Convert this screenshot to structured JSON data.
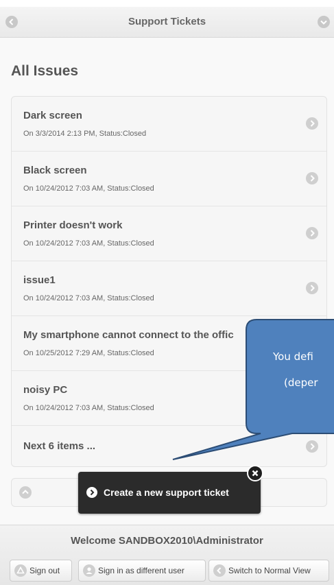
{
  "header": {
    "title": "Support Tickets"
  },
  "section": {
    "title": "All Issues"
  },
  "issues": [
    {
      "title": "Dark screen",
      "subtitle": "On 3/3/2014 2:13 PM, Status:Closed"
    },
    {
      "title": "Black screen",
      "subtitle": "On 10/24/2012 7:03 AM, Status:Closed"
    },
    {
      "title": "Printer doesn't work",
      "subtitle": "On 10/24/2012 7:03 AM, Status:Closed"
    },
    {
      "title": "issue1",
      "subtitle": "On 10/24/2012 7:03 AM, Status:Closed"
    },
    {
      "title": "My smartphone cannot connect to the offic",
      "subtitle": "On 10/25/2012 7:29 AM, Status:Closed"
    },
    {
      "title": "noisy PC",
      "subtitle": "On 10/24/2012 7:03 AM, Status:Closed"
    }
  ],
  "pager": {
    "next_label": "Next 6 items ..."
  },
  "tooltip": {
    "text": "Create a new support ticket"
  },
  "callout": {
    "line1": "You defi",
    "line2": "(deper",
    "fill_color": "#4f81bd",
    "border_color": "#2c4d75"
  },
  "footer": {
    "welcome": "Welcome SANDBOX2010\\Administrator",
    "sign_out": "Sign out",
    "sign_in_different": "Sign in as different user",
    "switch_view": "Switch to Normal View"
  },
  "icons": {
    "header_left": "back-arrow-icon",
    "header_right": "chevron-down-icon",
    "item_arrow": "chevron-right-icon",
    "up": "chevron-up-icon",
    "close": "close-icon",
    "sign_out": "warning-icon",
    "sign_in": "user-icon",
    "switch": "back-arrow-icon"
  }
}
